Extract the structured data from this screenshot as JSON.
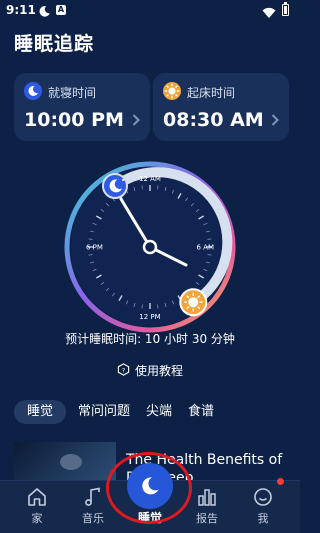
{
  "status_bar": {
    "time": "9:11",
    "a_icon": "A"
  },
  "page": {
    "title": "睡眠追踪"
  },
  "bedtime": {
    "label": "就寝时间",
    "time": "10:00 PM",
    "icon": "moon-icon",
    "icon_color": "#2f5be2"
  },
  "wakeup": {
    "label": "起床时间",
    "time": "08:30 AM",
    "icon": "sun-icon",
    "icon_color": "#f2a53c"
  },
  "clock": {
    "top": "12 AM",
    "right": "6 AM",
    "bottom": "12 PM",
    "left": "6 PM"
  },
  "estimate": {
    "text": "预计睡眠时间: 10 小时 30 分钟"
  },
  "tutorial": {
    "label": "使用教程"
  },
  "tabs": [
    {
      "label": "睡觉",
      "active": true
    },
    {
      "label": "常问问题",
      "active": false
    },
    {
      "label": "尖端",
      "active": false
    },
    {
      "label": "食谱",
      "active": false
    }
  ],
  "article": {
    "title_line1": "The Health Benefits of",
    "title_line2": "D... Sleep"
  },
  "nav": [
    {
      "label": "家",
      "icon": "home-icon"
    },
    {
      "label": "音乐",
      "icon": "music-note-icon"
    },
    {
      "label": "睡觉",
      "icon": "moon-icon",
      "active": true
    },
    {
      "label": "报告",
      "icon": "bar-chart-icon"
    },
    {
      "label": "我",
      "icon": "smiley-icon",
      "badge": true
    }
  ],
  "colors": {
    "background": "#0d2147",
    "card": "#18305a",
    "accent_blue": "#2657d8",
    "accent_orange": "#f2a53c",
    "annotation_red": "#e01820"
  }
}
